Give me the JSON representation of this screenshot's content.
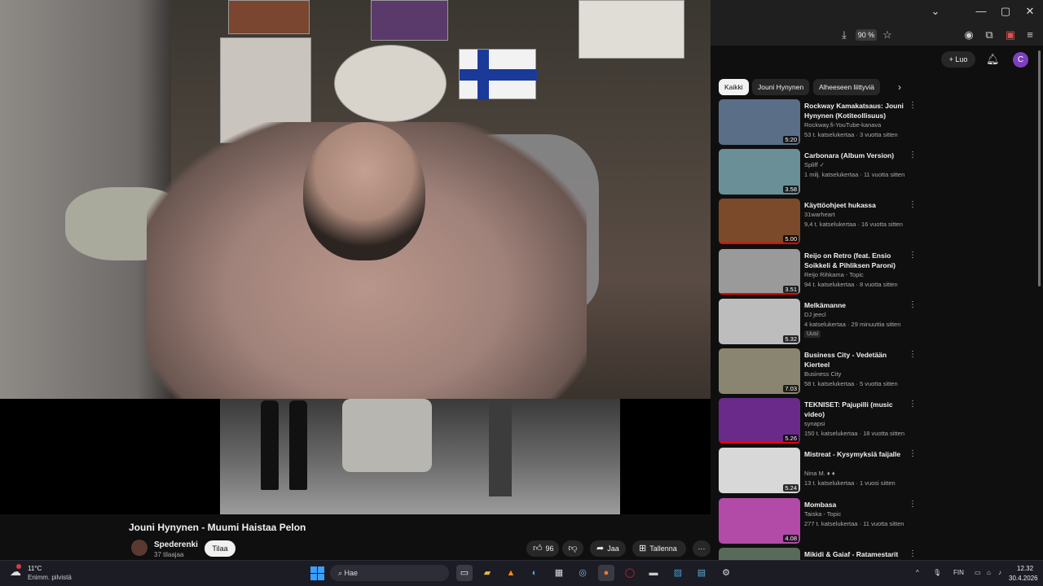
{
  "browser": {
    "zoom_label": "90 %",
    "window_controls": [
      "chevron-down",
      "minimize",
      "maximize",
      "close"
    ]
  },
  "video": {
    "title": "Jouni Hynynen - Muumi Haistaa Pelon",
    "channel_name": "Spederenki",
    "channel_subs": "37 tilaajaa",
    "subscribe_label": "Tilaa",
    "like_count": "96",
    "share_label": "Jaa",
    "save_label": "Tallenna"
  },
  "topbar": {
    "create_label": "Luo",
    "avatar_letter": "C"
  },
  "chips": [
    "Kaikki",
    "Jouni Hynynen",
    "Alheeseen liittyviä"
  ],
  "recommendations": [
    {
      "title": "Rockway Kamakatsaus: Jouni Hynynen (Kotiteollisuus)",
      "channel": "Rockway.fi-YouTube-kanava",
      "meta": "53 t. katselukertaa · 3 vuotta sitten",
      "duration": "5:20",
      "thumb_color": "#5b6e87",
      "progress": 0.0
    },
    {
      "title": "Carbonara (Album Version)",
      "channel": "Spliff ✓",
      "meta": "1 milj. katselukertaa · 11 vuotta sitten",
      "duration": "3.58",
      "thumb_color": "#6a8f96",
      "progress": 0.0
    },
    {
      "title": "Käyttöohjeet hukassa",
      "channel": "31warheart",
      "meta": "9,4 t. katselukertaa · 16 vuotta sitten",
      "duration": "5.00",
      "thumb_color": "#7a4a2a",
      "progress": 1.0
    },
    {
      "title": "Reijo on Retro (feat. Ensio Soikkeli & Pihliksen Paroni)",
      "channel": "Reijo Rihkama - Topic",
      "meta": "94 t. katselukertaa · 8 vuotta sitten",
      "duration": "3.51",
      "thumb_color": "#9a9a9a",
      "progress": 1.0
    },
    {
      "title": "Melkämanne",
      "channel": "DJ jeecl",
      "meta": "4 katselukertaa · 29 minuuttia sitten",
      "duration": "5.32",
      "thumb_color": "#bdbdbd",
      "progress": 0.0,
      "badge": "Uusi"
    },
    {
      "title": "Business City - Vedetään Kierteel",
      "channel": "Business City",
      "meta": "58 t. katselukertaa · 5 vuotta sitten",
      "duration": "7.03",
      "thumb_color": "#8a8570",
      "progress": 0.0
    },
    {
      "title": "TEKNISET: Pajupilli (music video)",
      "channel": "synapsi",
      "meta": "150 t. katselukertaa · 18 vuotta sitten",
      "duration": "5.26",
      "thumb_color": "#6a2a8a",
      "progress": 1.0
    },
    {
      "title": "Mistreat - Kysymyksiä faijalle",
      "channel": "Nina M. ♦ ♦",
      "meta": "13 t. katselukertaa · 1 vuosi sitten",
      "duration": "5.24",
      "thumb_color": "#d8d8d8",
      "progress": 0.0
    },
    {
      "title": "Mombasa",
      "channel": "Taiska - Topic",
      "meta": "277 t. katselukertaa · 11 vuotta sitten",
      "duration": "4.08",
      "thumb_color": "#b24aa8",
      "progress": 0.0
    },
    {
      "title": "Mikidi & Gaiaf - Ratamestarit",
      "channel": "",
      "meta": "",
      "duration": "",
      "thumb_color": "#5a6a5a",
      "progress": 0.0
    }
  ],
  "taskbar": {
    "weather_temp": "11°C",
    "weather_desc": "Enimm. pilvistä",
    "search_placeholder": "Hae",
    "language": "FIN",
    "time": "12.32",
    "date": "30.4.2026"
  },
  "colors": {
    "background": "#0f0f0f",
    "accent_red": "#ff0000",
    "chip_active_bg": "#f1f1f1"
  }
}
